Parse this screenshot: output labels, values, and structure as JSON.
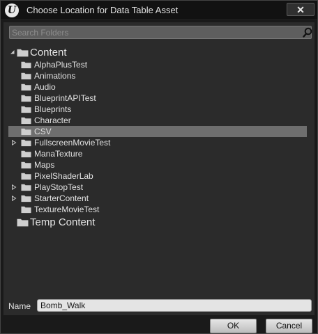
{
  "window": {
    "title": "Choose Location for Data Table Asset",
    "logo_glyph": "U",
    "close_glyph": "✕"
  },
  "search": {
    "placeholder": "Search Folders",
    "value": ""
  },
  "tree": {
    "roots": [
      {
        "label": "Content",
        "expanded": true,
        "children": [
          {
            "label": "AlphaPlusTest",
            "has_children": false,
            "selected": false
          },
          {
            "label": "Animations",
            "has_children": false,
            "selected": false
          },
          {
            "label": "Audio",
            "has_children": false,
            "selected": false
          },
          {
            "label": "BlueprintAPITest",
            "has_children": false,
            "selected": false
          },
          {
            "label": "Blueprints",
            "has_children": false,
            "selected": false
          },
          {
            "label": "Character",
            "has_children": false,
            "selected": false
          },
          {
            "label": "CSV",
            "has_children": false,
            "selected": true
          },
          {
            "label": "FullscreenMovieTest",
            "has_children": true,
            "selected": false
          },
          {
            "label": "ManaTexture",
            "has_children": false,
            "selected": false
          },
          {
            "label": "Maps",
            "has_children": false,
            "selected": false
          },
          {
            "label": "PixelShaderLab",
            "has_children": false,
            "selected": false
          },
          {
            "label": "PlayStopTest",
            "has_children": true,
            "selected": false
          },
          {
            "label": "StarterContent",
            "has_children": true,
            "selected": false
          },
          {
            "label": "TextureMovieTest",
            "has_children": false,
            "selected": false
          }
        ]
      },
      {
        "label": "Temp Content",
        "expanded": false,
        "children": []
      }
    ]
  },
  "name_field": {
    "label": "Name",
    "value": "Bomb_Walk"
  },
  "buttons": {
    "ok": "OK",
    "cancel": "Cancel"
  },
  "colors": {
    "selected_row": "#6e6e6e",
    "panel": "#2b2b2b",
    "folder": "#cfcfcf"
  }
}
